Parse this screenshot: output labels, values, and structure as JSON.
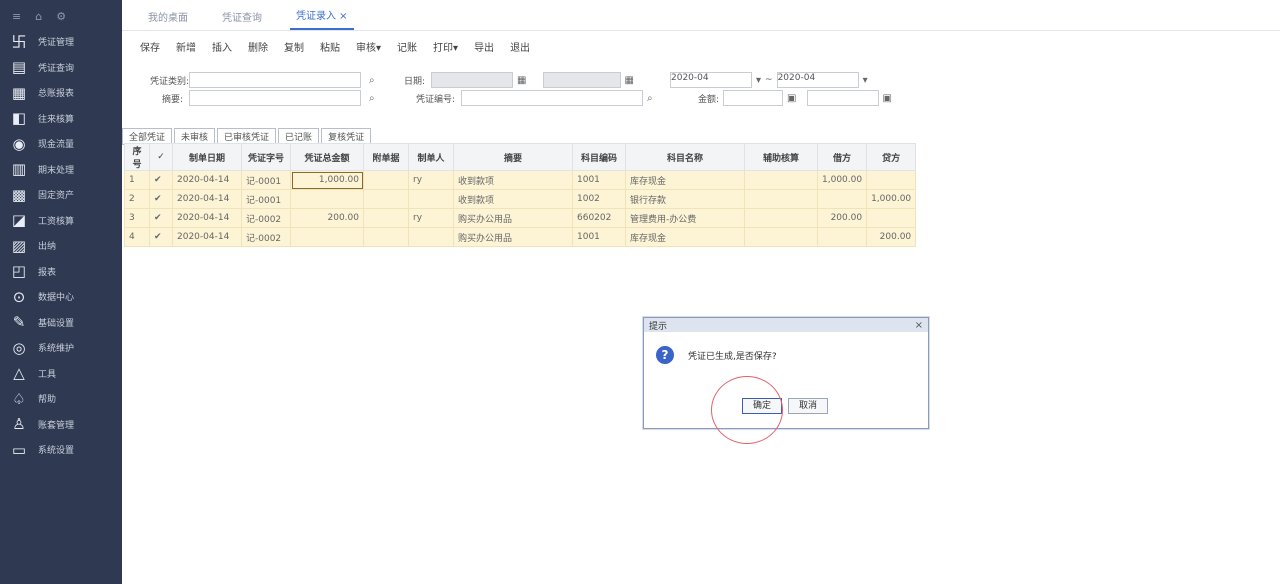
{
  "sidebar": {
    "top_icons": [
      "≡",
      "⌂",
      "⚙"
    ],
    "items": [
      {
        "icon": "卐",
        "label": "凭证管理"
      },
      {
        "icon": "▤",
        "label": "凭证查询"
      },
      {
        "icon": "▦",
        "label": "总账报表"
      },
      {
        "icon": "◧",
        "label": "往来核算"
      },
      {
        "icon": "◉",
        "label": "现金流量"
      },
      {
        "icon": "▥",
        "label": "期末处理"
      },
      {
        "icon": "▩",
        "label": "固定资产"
      },
      {
        "icon": "◪",
        "label": "工资核算"
      },
      {
        "icon": "▨",
        "label": "出纳"
      },
      {
        "icon": "◰",
        "label": "报表"
      },
      {
        "icon": "⊙",
        "label": "数据中心"
      },
      {
        "icon": "✎",
        "label": "基础设置"
      },
      {
        "icon": "◎",
        "label": "系统维护"
      },
      {
        "icon": "△",
        "label": "工具"
      },
      {
        "icon": "♤",
        "label": "帮助"
      },
      {
        "icon": "♙",
        "label": "账套管理"
      },
      {
        "icon": "▭",
        "label": "系统设置"
      }
    ]
  },
  "tabs": [
    "我的桌面",
    "凭证查询",
    "凭证录入 ×"
  ],
  "toolbar": [
    "保存",
    "新增",
    "插入",
    "删除",
    "复制",
    "粘贴",
    "审核▾",
    "记账",
    "打印▾",
    "导出",
    "退出"
  ],
  "filters": {
    "voucher_word_label": "凭证类别:",
    "summary_label": "摘要:",
    "date_label": "日期:",
    "number_label": "凭证编号:",
    "amount_label": "金额:",
    "date_from": "2020-04",
    "date_to": "2020-04",
    "period_sep": "~"
  },
  "voucher_tabs": [
    "全部凭证",
    "未审核",
    "已审核凭证",
    "已记账",
    "复核凭证"
  ],
  "table": {
    "headers": [
      "序号",
      "✓",
      "制单日期",
      "凭证字号",
      "凭证总金额",
      "附单据",
      "制单人",
      "摘要",
      "科目编码",
      "科目名称",
      "辅助核算",
      "借方",
      "贷方"
    ],
    "rows": [
      [
        "1",
        "✔",
        "2020-04-14",
        "记-0001",
        "1,000.00",
        "",
        "ry",
        "收到款项",
        "1001",
        "库存现金",
        "",
        "1,000.00",
        ""
      ],
      [
        "2",
        "✔",
        "2020-04-14",
        "记-0001",
        "",
        "",
        "",
        "收到款项",
        "1002",
        "银行存款",
        "",
        "",
        "1,000.00"
      ],
      [
        "3",
        "✔",
        "2020-04-14",
        "记-0002",
        "200.00",
        "",
        "ry",
        "购买办公用品",
        "660202",
        "管理费用-办公费",
        "",
        "200.00",
        ""
      ],
      [
        "4",
        "✔",
        "2020-04-14",
        "记-0002",
        "",
        "",
        "",
        "购买办公用品",
        "1001",
        "库存现金",
        "",
        "",
        "200.00"
      ]
    ]
  },
  "dialog": {
    "title": "提示",
    "close": "×",
    "message": "凭证已生成,是否保存?",
    "ok": "确定",
    "cancel": "取消"
  },
  "colors": {
    "sidebar": "#2f3a52",
    "row_highlight": "#fdf4d6",
    "accent": "#3a6fd0"
  }
}
